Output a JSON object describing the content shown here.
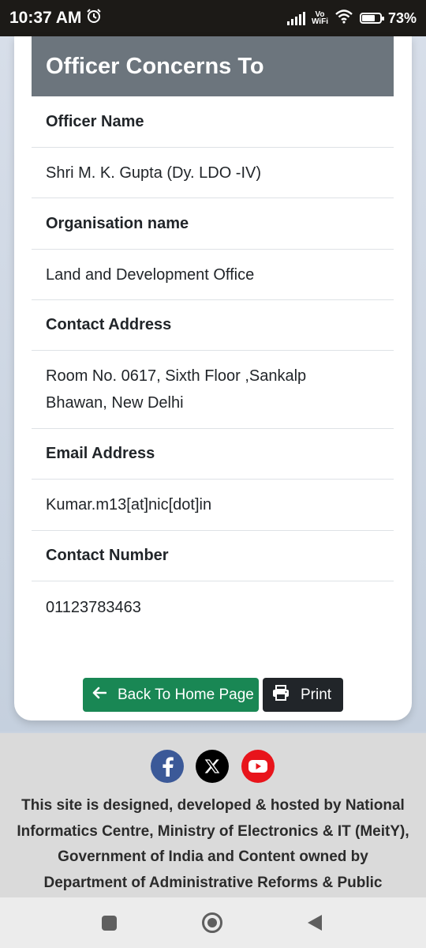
{
  "status_bar": {
    "time": "10:37 AM",
    "alarm_icon": "alarm-clock-icon",
    "network": "Vo WiFi",
    "network_top": "Vo",
    "network_bottom": "WiFi",
    "battery_percent": "73%",
    "battery_level": 0.73
  },
  "card": {
    "title": "Officer Concerns To",
    "fields": [
      {
        "label": "Officer Name",
        "value": "Shri M. K. Gupta (Dy. LDO -IV)"
      },
      {
        "label": "Organisation name",
        "value": "Land and Development Office"
      },
      {
        "label": "Contact Address",
        "value_line1": "Room No. 0617, Sixth Floor ,Sankalp",
        "value_line2": "Bhawan, New Delhi"
      },
      {
        "label": "Email Address",
        "value": "Kumar.m13[at]nic[dot]in"
      },
      {
        "label": "Contact Number",
        "value": "01123783463"
      }
    ]
  },
  "buttons": {
    "back_home": "Back To Home Page",
    "print": "Print"
  },
  "footer": {
    "social_icons": [
      "facebook-icon",
      "x-twitter-icon",
      "youtube-icon"
    ],
    "text_lines": [
      "This site is designed, developed & hosted by National",
      "Informatics Centre, Ministry of Electronics & IT (MeitY),",
      "Government of India and Content owned by",
      "Department of Administrative Reforms & Public"
    ]
  },
  "colors": {
    "header_bg": "#6c757d",
    "home_button": "#198754",
    "print_button": "#212529",
    "footer_bg": "#dadada",
    "facebook": "#3b5998",
    "youtube": "#e8141b"
  }
}
